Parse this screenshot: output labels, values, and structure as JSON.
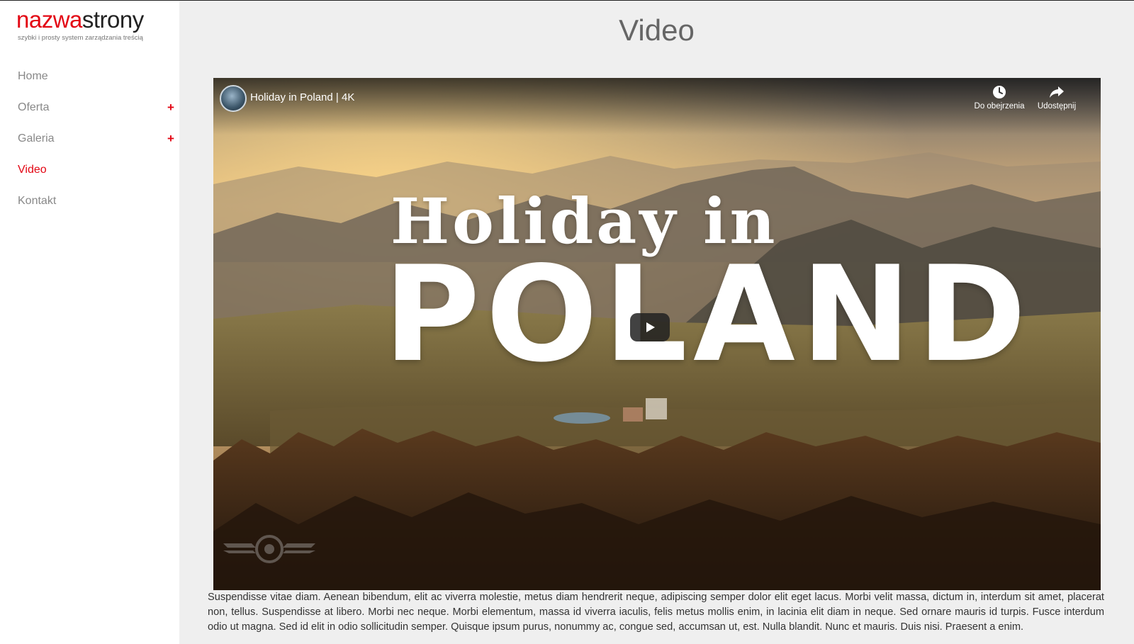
{
  "site": {
    "logo_part1": "nazwa",
    "logo_part2": "strony",
    "tagline": "szybki i prosty system zarządzania treścią"
  },
  "nav": {
    "items": [
      {
        "label": "Home",
        "has_submenu": false,
        "active": false
      },
      {
        "label": "Oferta",
        "has_submenu": true,
        "active": false
      },
      {
        "label": "Galeria",
        "has_submenu": true,
        "active": false
      },
      {
        "label": "Video",
        "has_submenu": false,
        "active": true
      },
      {
        "label": "Kontakt",
        "has_submenu": false,
        "active": false
      }
    ],
    "submenu_symbol": "+"
  },
  "page": {
    "title": "Video"
  },
  "video": {
    "title": "Holiday in Poland | 4K",
    "thumbnail_line1": "Holiday in",
    "thumbnail_line2": "POLAND",
    "watch_later_label": "Do obejrzenia",
    "share_label": "Udostępnij",
    "icons": {
      "avatar": "channel-avatar",
      "watch_later": "clock-icon",
      "share": "share-arrow-icon",
      "play": "play-icon"
    }
  },
  "content": {
    "paragraph": "Suspendisse vitae diam. Aenean bibendum, elit ac viverra molestie, metus diam hendrerit neque, adipiscing semper dolor elit eget lacus. Morbi velit massa, dictum in, interdum sit amet, placerat non, tellus. Suspendisse at libero. Morbi nec neque. Morbi elementum, massa id viverra iaculis, felis metus mollis enim, in lacinia elit diam in neque. Sed ornare mauris id turpis. Fusce interdum odio ut magna. Sed id elit in odio sollicitudin semper. Quisque ipsum purus, nonummy ac, congue sed, accumsan ut, est. Nulla blandit. Nunc et mauris. Duis nisi. Praesent a enim."
  },
  "colors": {
    "accent": "#e30613",
    "nav_text": "#888888",
    "background": "#efefef",
    "sidebar": "#ffffff"
  }
}
